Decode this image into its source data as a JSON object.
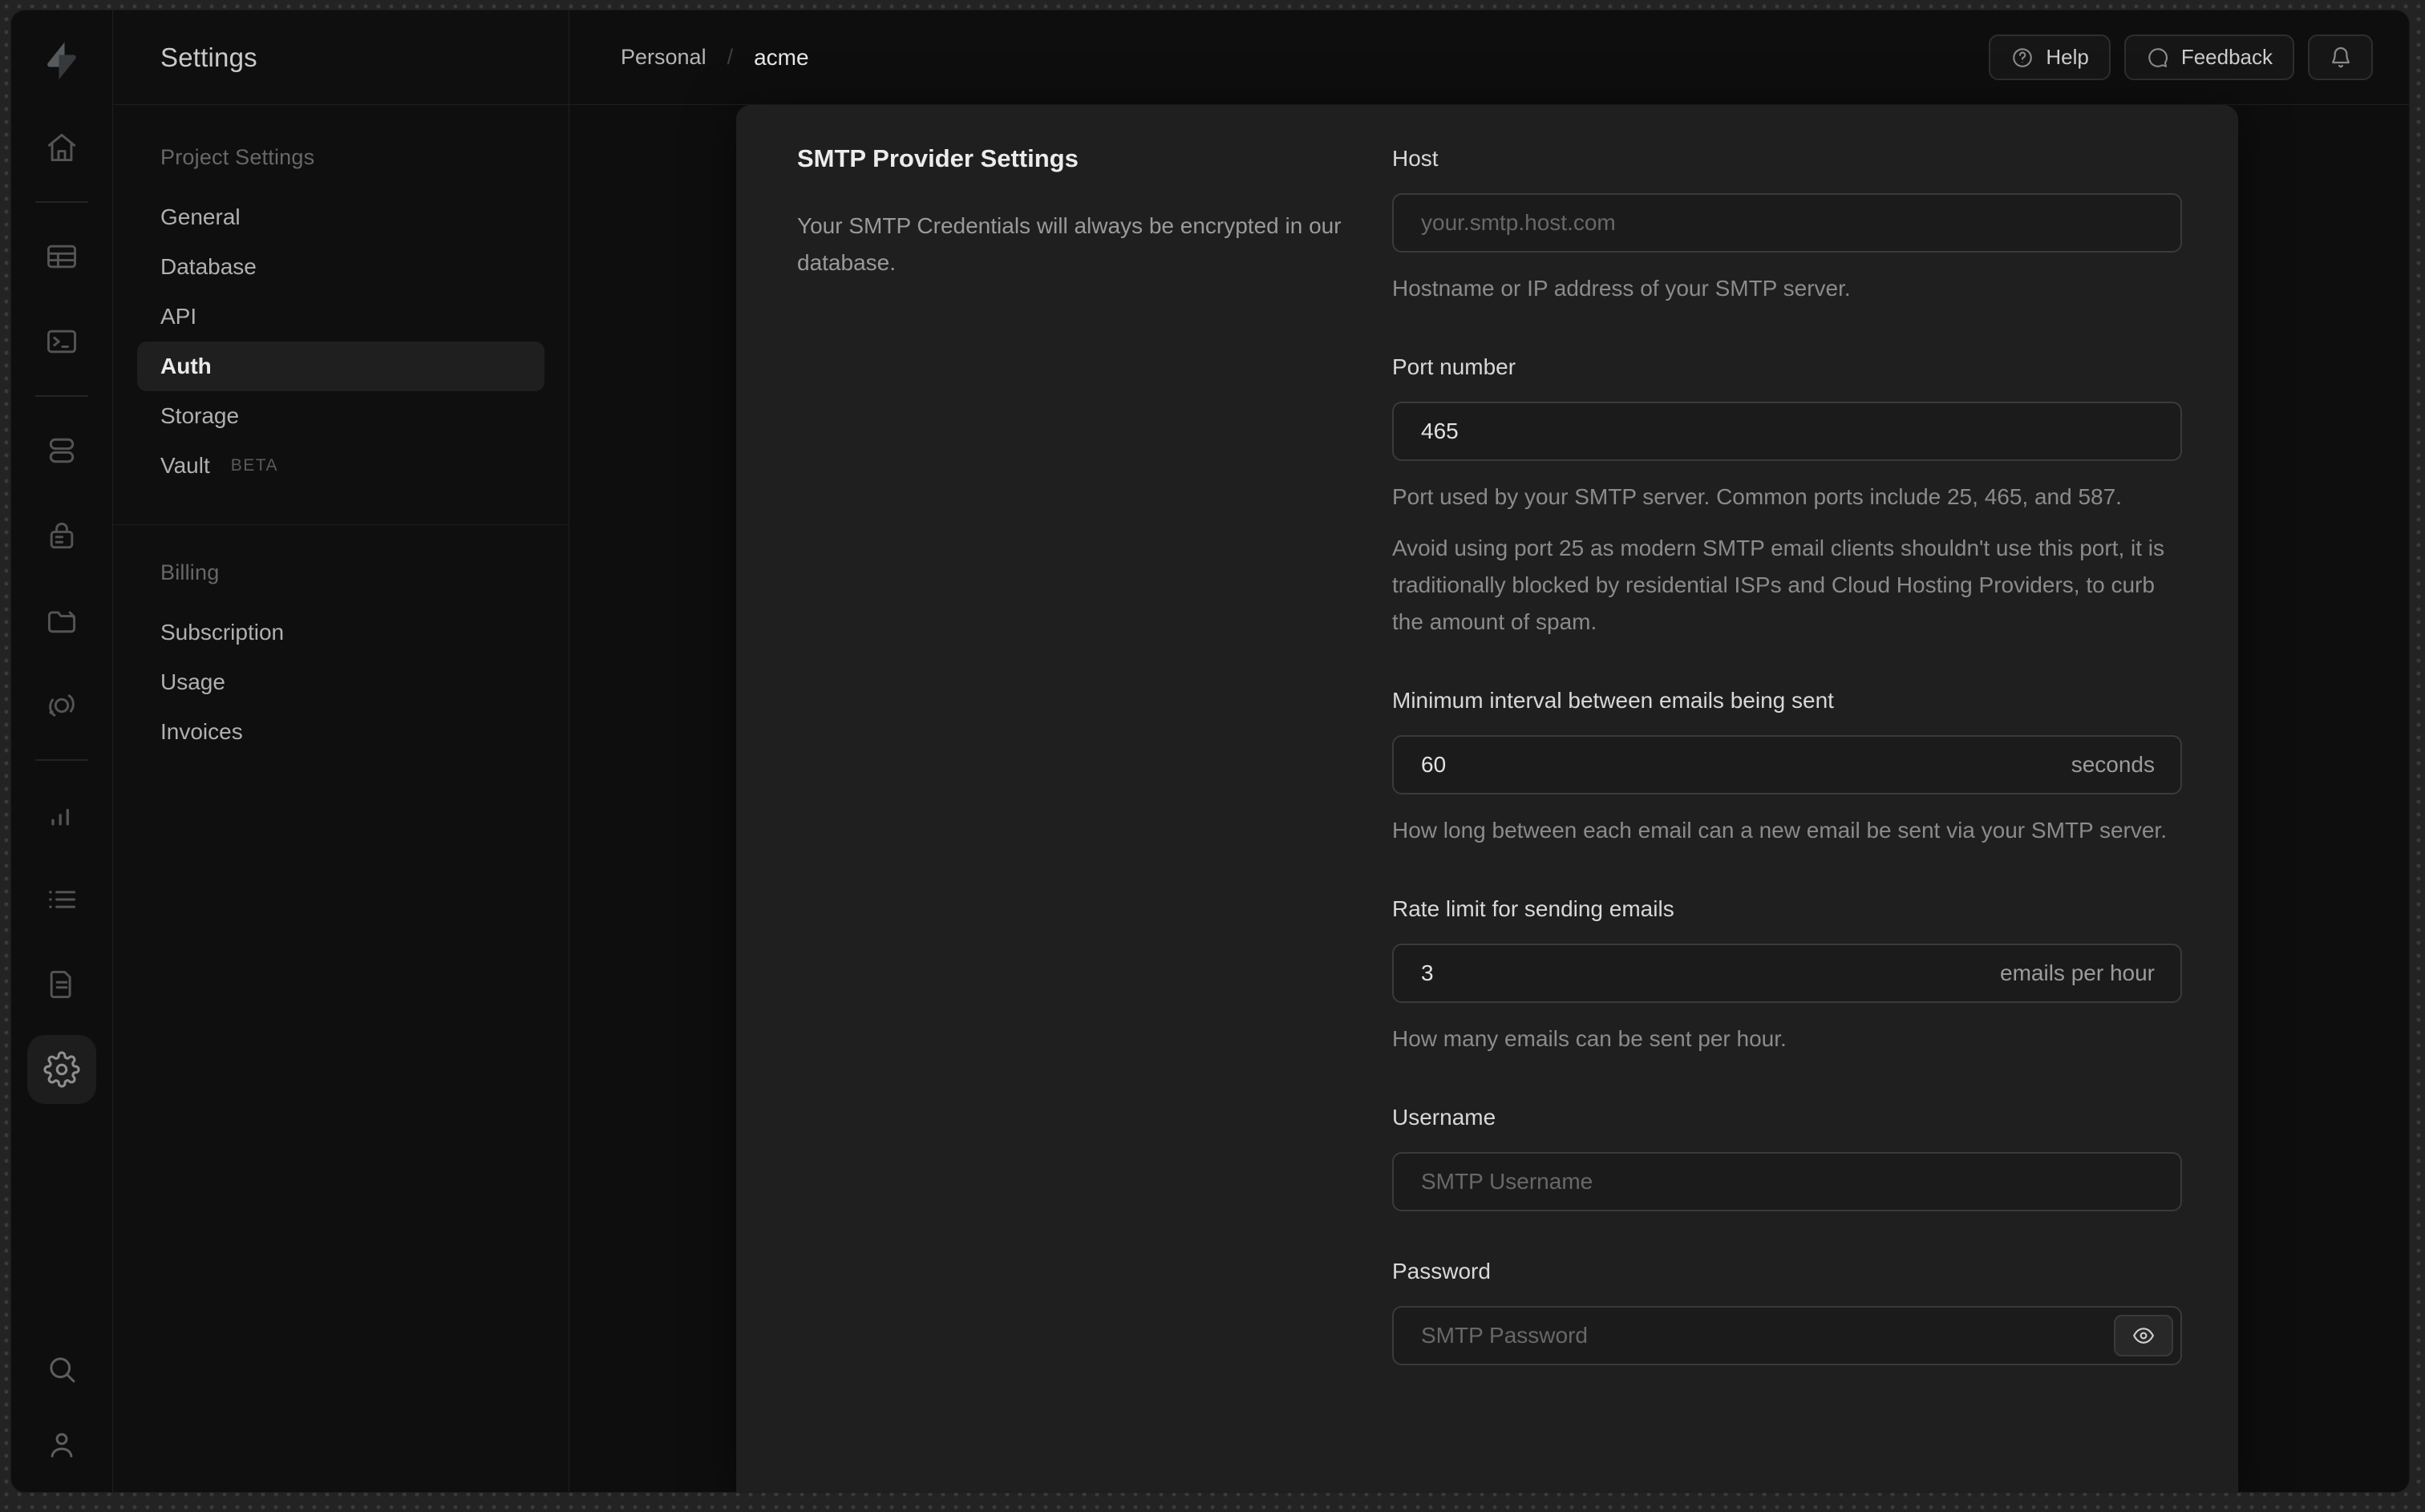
{
  "colors": {
    "frame_bg": "#232323",
    "window_bg": "#0e0e0e",
    "panel_bg": "#1f1f1f",
    "border": "#1f1f1f",
    "input_border": "#3a3a3a",
    "active_item_bg": "#1f1f1f",
    "text_primary": "#eaeaea",
    "text_muted": "#8b8b8b"
  },
  "rail": {
    "icons": [
      "supabase-logo",
      "home",
      "table-editor",
      "sql-editor",
      "database",
      "auth",
      "storage",
      "edge-functions",
      "reports",
      "logs",
      "api-docs",
      "project-settings",
      "search",
      "account"
    ]
  },
  "sidebar": {
    "title": "Settings",
    "sections": [
      {
        "header": "Project Settings",
        "items": [
          {
            "label": "General"
          },
          {
            "label": "Database"
          },
          {
            "label": "API"
          },
          {
            "label": "Auth",
            "active": true
          },
          {
            "label": "Storage"
          },
          {
            "label": "Vault",
            "badge": "BETA"
          }
        ]
      },
      {
        "header": "Billing",
        "items": [
          {
            "label": "Subscription"
          },
          {
            "label": "Usage"
          },
          {
            "label": "Invoices"
          }
        ]
      }
    ]
  },
  "topbar": {
    "breadcrumb": {
      "org": "Personal",
      "separator": "/",
      "project": "acme"
    },
    "help": "Help",
    "feedback": "Feedback",
    "icons": [
      "help-circle-icon",
      "chat-bubble-icon",
      "bell-icon"
    ]
  },
  "panel": {
    "title": "SMTP Provider Settings",
    "description": "Your SMTP Credentials will always be encrypted in our database.",
    "fields": {
      "host": {
        "label": "Host",
        "placeholder": "your.smtp.host.com",
        "helper": "Hostname or IP address of your SMTP server."
      },
      "port": {
        "label": "Port number",
        "value": "465",
        "helper": "Port used by your SMTP server. Common ports include 25, 465, and 587.",
        "note": "Avoid using port 25 as modern SMTP email clients shouldn't use this port, it is traditionally blocked by residential ISPs and Cloud Hosting Providers, to curb the amount of spam."
      },
      "interval": {
        "label": "Minimum interval between emails being sent",
        "value": "60",
        "suffix": "seconds",
        "helper": "How long between each email can a new email be sent via your SMTP server."
      },
      "rate": {
        "label": "Rate limit for sending emails",
        "value": "3",
        "suffix": "emails per hour",
        "helper": "How many emails can be sent per hour."
      },
      "username": {
        "label": "Username",
        "placeholder": "SMTP Username"
      },
      "password": {
        "label": "Password",
        "placeholder": "SMTP Password"
      }
    }
  }
}
